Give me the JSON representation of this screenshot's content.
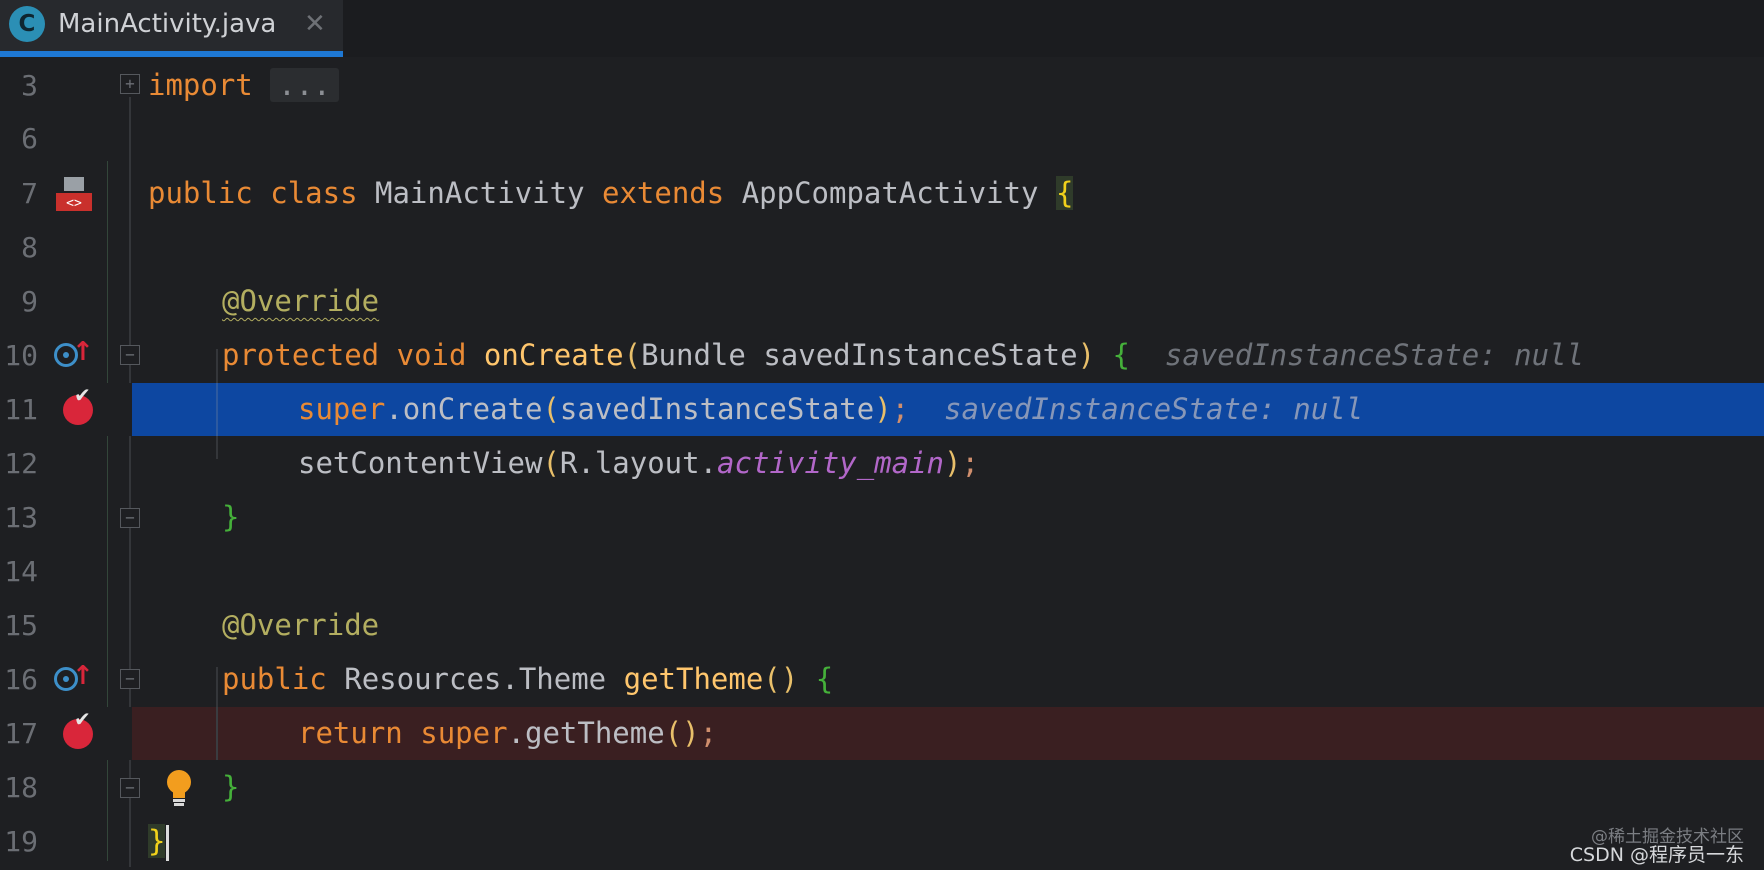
{
  "tab": {
    "icon_letter": "C",
    "filename": "MainActivity.java",
    "close_glyph": "✕"
  },
  "editor": {
    "lines": [
      {
        "num": "3"
      },
      {
        "num": "6"
      },
      {
        "num": "7"
      },
      {
        "num": "8"
      },
      {
        "num": "9"
      },
      {
        "num": "10"
      },
      {
        "num": "11"
      },
      {
        "num": "12"
      },
      {
        "num": "13"
      },
      {
        "num": "14"
      },
      {
        "num": "15"
      },
      {
        "num": "16"
      },
      {
        "num": "17"
      },
      {
        "num": "18"
      },
      {
        "num": "19"
      }
    ],
    "code": {
      "l3_import": "import",
      "l3_fold": "...",
      "l7_public": "public",
      "l7_class": "class",
      "l7_name": "MainActivity",
      "l7_extends": "extends",
      "l7_super": "AppCompatActivity",
      "l7_brace": "{",
      "l9_annotation": "@Override",
      "l10_protected": "protected",
      "l10_void": "void",
      "l10_method": "onCreate",
      "l10_open": "(",
      "l10_type": "Bundle",
      "l10_param": "savedInstanceState",
      "l10_close": ")",
      "l10_brace": "{",
      "l10_hint": "savedInstanceState: null",
      "l11_super": "super",
      "l11_call": ".onCreate",
      "l11_open": "(",
      "l11_arg": "savedInstanceState",
      "l11_close": ")",
      "l11_semi": ";",
      "l11_hint": "savedInstanceState: null",
      "l12_call": "setContentView",
      "l12_open": "(",
      "l12_ref": "R.layout.",
      "l12_field": "activity_main",
      "l12_close": ")",
      "l12_semi": ";",
      "l13_brace": "}",
      "l15_annotation": "@Override",
      "l16_public": "public",
      "l16_type": "Resources.Theme",
      "l16_method": "getTheme",
      "l16_parens": "()",
      "l16_brace": "{",
      "l17_return": "return",
      "l17_super": "super",
      "l17_call": ".getTheme",
      "l17_parens": "()",
      "l17_semi": ";",
      "l18_brace": "}",
      "l19_brace": "}"
    }
  },
  "watermark": {
    "line1": "@稀土掘金技术社区",
    "line2": "CSDN @程序员一东"
  },
  "colors": {
    "background": "#1e1f22",
    "current_line": "#0d47a1",
    "breakpoint_line": "#3a1f21",
    "breakpoint": "#d9263a",
    "keyword": "#cf8e6d",
    "annotation": "#b3ae60",
    "method_decl": "#ffc66d",
    "field": "#b267c9"
  },
  "icons": {
    "file": "java-class-icon",
    "gutter_line7": "xml-layout-icon",
    "gutter_line10": "override-method-icon",
    "gutter_line11": "breakpoint-icon",
    "gutter_line16": "override-method-icon",
    "gutter_line17": "breakpoint-icon",
    "gutter_line18": "lightbulb-icon"
  }
}
